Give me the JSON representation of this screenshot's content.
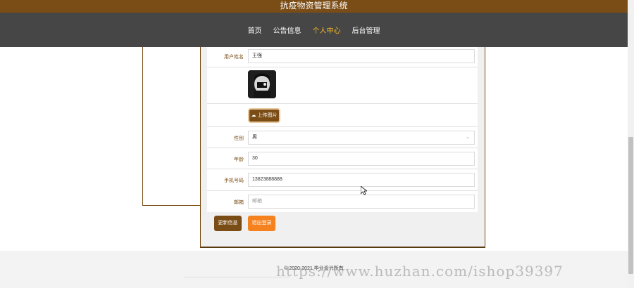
{
  "app_title": "抗疫物资管理系统",
  "nav": {
    "items": [
      {
        "label": "首页",
        "active": false
      },
      {
        "label": "公告信息",
        "active": false
      },
      {
        "label": "个人中心",
        "active": true
      },
      {
        "label": "后台管理",
        "active": false
      }
    ]
  },
  "form": {
    "name": {
      "label": "用户姓名",
      "value": "王强"
    },
    "upload_label": "上传图片",
    "gender": {
      "label": "性别",
      "value": "男"
    },
    "age": {
      "label": "年龄",
      "value": "30"
    },
    "phone": {
      "label": "手机号码",
      "value": "13823888888"
    },
    "email": {
      "label": "邮箱",
      "placeholder": "邮箱"
    }
  },
  "buttons": {
    "update_label": "更新信息",
    "logout_label": "退出登录"
  },
  "footer": {
    "copyright": "© 2020-2021 毕业设计所有"
  },
  "watermark_text": "https://www.huzhan.com/ishop39397",
  "colors": {
    "brand": "#7b4d16",
    "nav_bg": "#464646",
    "nav_active": "#f4b524",
    "logout_button": "#f5821f"
  }
}
